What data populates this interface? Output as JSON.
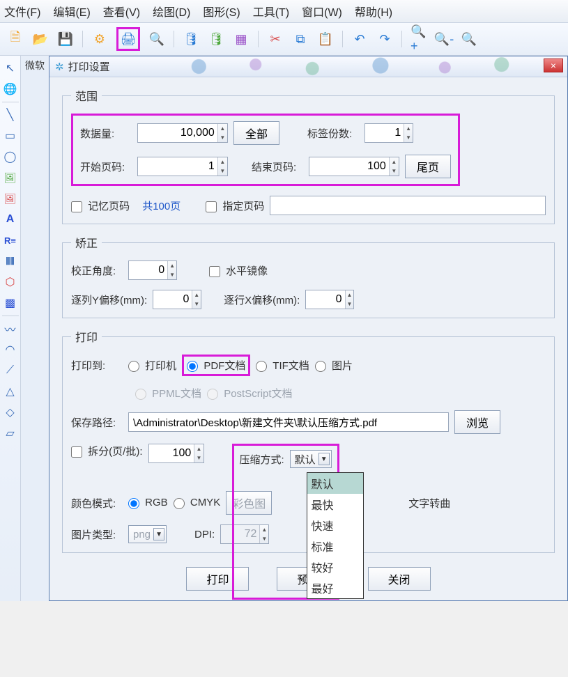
{
  "menu": {
    "file": "文件(F)",
    "edit": "编辑(E)",
    "view": "查看(V)",
    "draw": "绘图(D)",
    "shape": "图形(S)",
    "tool": "工具(T)",
    "window": "窗口(W)",
    "help": "帮助(H)"
  },
  "tab_label": "微软",
  "dialog": {
    "title": "打印设置",
    "close": "×"
  },
  "range": {
    "legend": "范围",
    "data_qty_label": "数据量:",
    "data_qty": "10,000",
    "all_btn": "全部",
    "copies_label": "标签份数:",
    "copies": "1",
    "start_page_label": "开始页码:",
    "start_page": "1",
    "end_page_label": "结束页码:",
    "end_page": "100",
    "last_page_btn": "尾页",
    "remember_page": "记忆页码",
    "total_pages": "共100页",
    "specify_page": "指定页码",
    "specify_value": ""
  },
  "correct": {
    "legend": "矫正",
    "angle_label": "校正角度:",
    "angle": "0",
    "mirror": "水平镜像",
    "col_offset_label": "逐列Y偏移(mm):",
    "col_offset": "0",
    "row_offset_label": "逐行X偏移(mm):",
    "row_offset": "0"
  },
  "print": {
    "legend": "打印",
    "to_label": "打印到:",
    "opt_printer": "打印机",
    "opt_pdf": "PDF文档",
    "opt_tif": "TIF文档",
    "opt_img": "图片",
    "opt_ppml": "PPML文档",
    "opt_ps": "PostScript文档",
    "path_label": "保存路径:",
    "path_value": "\\Administrator\\Desktop\\新建文件夹\\默认压缩方式.pdf",
    "browse_btn": "浏览",
    "split_label": "拆分(页/批):",
    "split_value": "100",
    "comp_label": "压缩方式:",
    "comp_value": "默认",
    "comp_options": [
      "默认",
      "最快",
      "快速",
      "标准",
      "较好",
      "最好"
    ],
    "color_label": "颜色模式:",
    "rgb": "RGB",
    "cmyk": "CMYK",
    "color_img_btn": "彩色图",
    "text_curve": "文字转曲",
    "img_type_label": "图片类型:",
    "img_type_value": "png",
    "dpi_label": "DPI:",
    "dpi_value": "72"
  },
  "buttons": {
    "print": "打印",
    "preview": "预览",
    "close": "关闭"
  }
}
